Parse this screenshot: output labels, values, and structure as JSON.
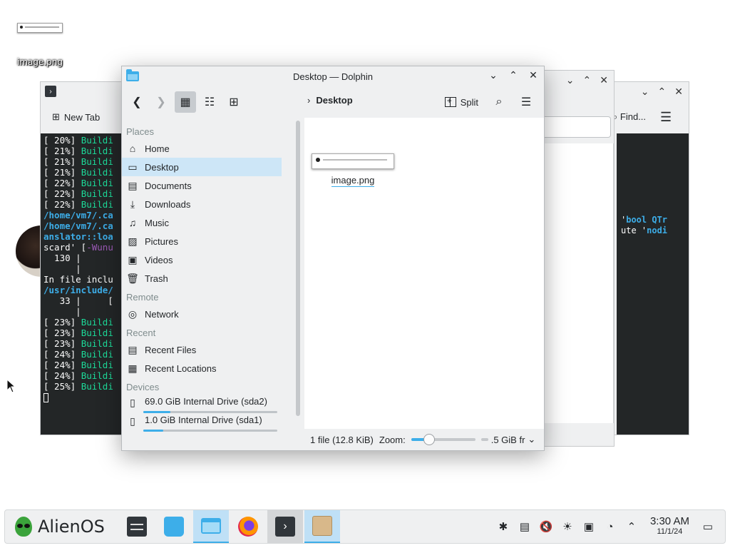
{
  "desktop": {
    "icons": [
      {
        "label": "image.png"
      }
    ]
  },
  "back_terminal": {
    "new_tab_label": "New Tab",
    "lines": [
      {
        "prefix": "[ 20%] ",
        "text": "Buildi",
        "style": "green"
      },
      {
        "prefix": "[ 21%] ",
        "text": "Buildi",
        "style": "green"
      },
      {
        "prefix": "[ 21%] ",
        "text": "Buildi",
        "style": "green"
      },
      {
        "prefix": "[ 21%] ",
        "text": "Buildi",
        "style": "green"
      },
      {
        "prefix": "[ 22%] ",
        "text": "Buildi",
        "style": "green"
      },
      {
        "prefix": "[ 22%] ",
        "text": "Buildi",
        "style": "green"
      },
      {
        "prefix": "[ 22%] ",
        "text": "Buildi",
        "style": "green"
      },
      {
        "prefix": "",
        "text": "/home/vm7/.ca",
        "style": "blue"
      },
      {
        "prefix": "",
        "text": "/home/vm7/.ca",
        "style": "blue"
      },
      {
        "prefix": "",
        "text": "anslator::loa",
        "style": "blue"
      },
      {
        "prefix": "scard' [",
        "text": "-Wunu",
        "style": "purple"
      },
      {
        "prefix": "  130 |     ",
        "text": "",
        "style": "plain"
      },
      {
        "prefix": "      |     ",
        "text": "",
        "style": "plain"
      },
      {
        "prefix": "In file inclu",
        "text": "",
        "style": "plain"
      },
      {
        "prefix": "",
        "text": "",
        "style": "plain"
      },
      {
        "prefix": "",
        "text": "",
        "style": "plain"
      },
      {
        "prefix": "",
        "text": "",
        "style": "plain"
      },
      {
        "prefix": "",
        "text": "/usr/include/",
        "style": "blue"
      },
      {
        "prefix": "   33 |     [",
        "text": "",
        "style": "plain"
      },
      {
        "prefix": "      |",
        "text": "",
        "style": "plain"
      },
      {
        "prefix": "[ 23%] ",
        "text": "Buildi",
        "style": "green"
      },
      {
        "prefix": "[ 23%] ",
        "text": "Buildi",
        "style": "green"
      },
      {
        "prefix": "[ 23%] ",
        "text": "Buildi",
        "style": "green"
      },
      {
        "prefix": "[ 24%] ",
        "text": "Buildi",
        "style": "green"
      },
      {
        "prefix": "[ 24%] ",
        "text": "Buildi",
        "style": "green"
      },
      {
        "prefix": "[ 24%] ",
        "text": "Buildi",
        "style": "green"
      },
      {
        "prefix": "[ 25%] ",
        "text": "Buildi",
        "style": "green"
      }
    ]
  },
  "back_right": {
    "find_label": "Find...",
    "lines": [
      {
        "text": "'",
        "kw": "bool QTr"
      },
      {
        "text": "ute '",
        "kw": "nodi"
      }
    ]
  },
  "dolphin": {
    "title": "Desktop — Dolphin",
    "breadcrumb": "Desktop",
    "split_label": "Split",
    "places": {
      "sections": [
        {
          "header": "Places",
          "items": [
            {
              "label": "Home",
              "icon": "home-icon",
              "glyph": "⌂"
            },
            {
              "label": "Desktop",
              "icon": "desktop-icon",
              "glyph": "▭",
              "selected": true
            },
            {
              "label": "Documents",
              "icon": "documents-icon",
              "glyph": "▤"
            },
            {
              "label": "Downloads",
              "icon": "downloads-icon",
              "glyph": "⤓"
            },
            {
              "label": "Music",
              "icon": "music-icon",
              "glyph": "♫"
            },
            {
              "label": "Pictures",
              "icon": "pictures-icon",
              "glyph": "▨"
            },
            {
              "label": "Videos",
              "icon": "videos-icon",
              "glyph": "▣"
            },
            {
              "label": "Trash",
              "icon": "trash-icon",
              "glyph": "🗑"
            }
          ]
        },
        {
          "header": "Remote",
          "items": [
            {
              "label": "Network",
              "icon": "network-icon",
              "glyph": "◎"
            }
          ]
        },
        {
          "header": "Recent",
          "items": [
            {
              "label": "Recent Files",
              "icon": "recent-files-icon",
              "glyph": "▤"
            },
            {
              "label": "Recent Locations",
              "icon": "recent-locations-icon",
              "glyph": "▦"
            }
          ]
        }
      ],
      "devices_header": "Devices",
      "devices": [
        {
          "label": "69.0 GiB Internal Drive (sda2)",
          "used_fraction": 0.2
        },
        {
          "label": "1.0 GiB Internal Drive (sda1)",
          "used_fraction": 0.15
        }
      ]
    },
    "files": [
      {
        "name": "image.png"
      }
    ],
    "status": {
      "file_count": "1 file (12.8 KiB)",
      "zoom_label": "Zoom:",
      "zoom_fraction": 0.28,
      "free_space": ".5 GiB fr"
    }
  },
  "taskbar": {
    "launcher_label": "AlienOS",
    "tasks": [
      {
        "name": "system-settings-task",
        "icon": "settings-icon",
        "state": "normal"
      },
      {
        "name": "discover-task",
        "icon": "store-icon",
        "state": "normal"
      },
      {
        "name": "dolphin-task",
        "icon": "folder-icon",
        "state": "active"
      },
      {
        "name": "firefox-task",
        "icon": "firefox-icon",
        "state": "normal"
      },
      {
        "name": "konsole-task",
        "icon": "terminal-icon",
        "state": "open"
      },
      {
        "name": "package-task",
        "icon": "package-icon",
        "state": "active"
      }
    ],
    "tray": [
      {
        "name": "bluetooth-icon",
        "glyph": "✱"
      },
      {
        "name": "clipboard-icon",
        "glyph": "▤"
      },
      {
        "name": "volume-muted-icon",
        "glyph": "🔇"
      },
      {
        "name": "brightness-icon",
        "glyph": "☀"
      },
      {
        "name": "disk-icon",
        "glyph": "▣"
      },
      {
        "name": "updates-icon",
        "glyph": "◔"
      },
      {
        "name": "expand-tray-icon",
        "glyph": "⌃"
      }
    ],
    "clock": {
      "time": "3:30 AM",
      "date": "11/1/24"
    }
  },
  "colors": {
    "accent": "#3daee9",
    "selection": "#cde6f7",
    "terminal_bg": "#232627",
    "terminal_green": "#1cdc9a"
  }
}
